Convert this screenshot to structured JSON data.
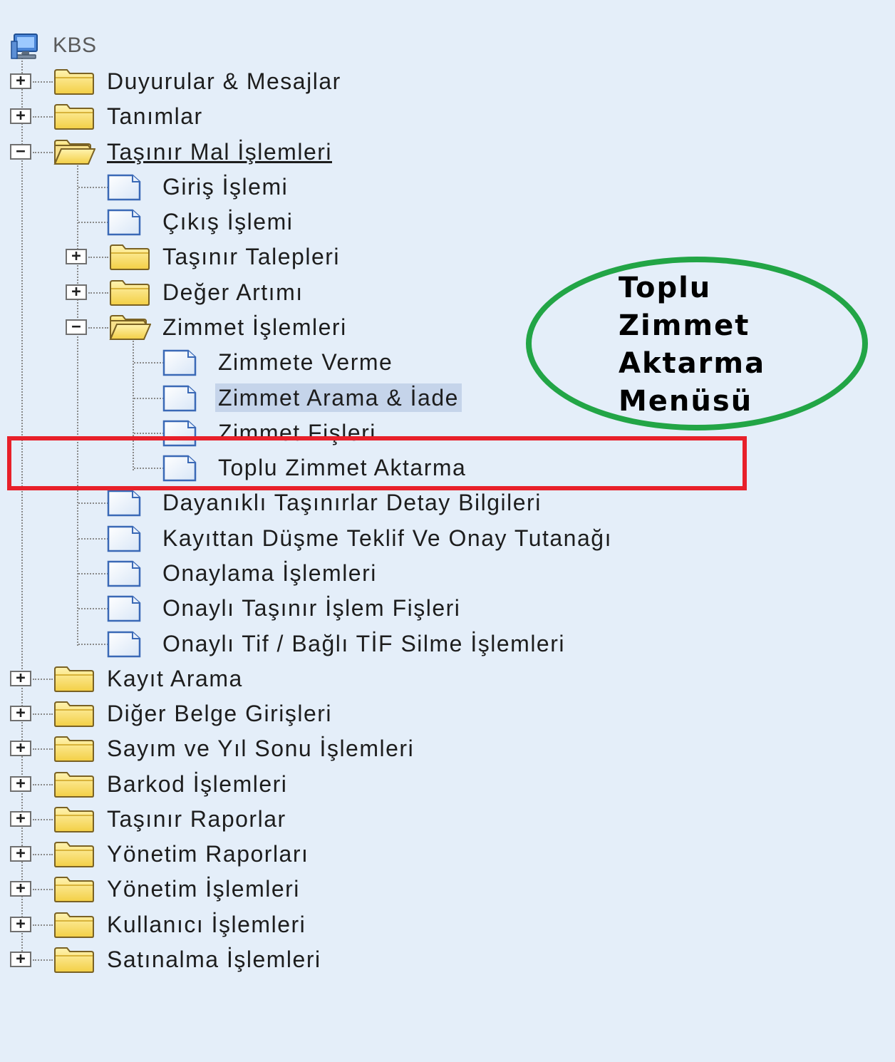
{
  "tree": {
    "root": {
      "label": "KBS",
      "icon": "computer-icon"
    },
    "duyurular": "Duyurular & Mesajlar",
    "tanimlar": "Tanımlar",
    "tasinir_mal": {
      "label": "Taşınır Mal İşlemleri",
      "giris": "Giriş İşlemi",
      "cikis": "Çıkış İşlemi",
      "talepler": "Taşınır Talepleri",
      "deger_artimi": "Değer Artımı",
      "zimmet": {
        "label": "Zimmet İşlemleri",
        "zimmete_verme": "Zimmete Verme",
        "arama_iade": "Zimmet Arama & İade",
        "fisleri": "Zimmet Fişleri",
        "toplu_aktarma": "Toplu Zimmet Aktarma"
      },
      "dayanikli": "Dayanıklı Taşınırlar Detay Bilgileri",
      "kayittan_dusme": "Kayıttan Düşme Teklif Ve Onay Tutanağı",
      "onaylama": "Onaylama İşlemleri",
      "onayli_fisler": "Onaylı Taşınır İşlem Fişleri",
      "onayli_tif_silme": "Onaylı Tif / Bağlı TİF Silme İşlemleri"
    },
    "kayit_arama": "Kayıt Arama",
    "diger_belge": "Diğer Belge Girişleri",
    "sayim": "Sayım ve Yıl Sonu İşlemleri",
    "barkod": "Barkod İşlemleri",
    "tasinir_raporlar": "Taşınır Raporlar",
    "yonetim_raporlari": "Yönetim Raporları",
    "yonetim_islemleri": "Yönetim İşlemleri",
    "kullanici": "Kullanıcı İşlemleri",
    "satinalma": "Satınalma İşlemleri"
  },
  "toggles": {
    "expand": "+",
    "collapse": "−"
  },
  "annotation": {
    "lines": [
      "Toplu",
      "Zimmet",
      "Aktarma",
      "Menüsü"
    ],
    "circle_color": "#22a546",
    "box_color": "#e8202a"
  },
  "colors": {
    "background": "#e4eef9",
    "selected": "#c5d4ea"
  }
}
